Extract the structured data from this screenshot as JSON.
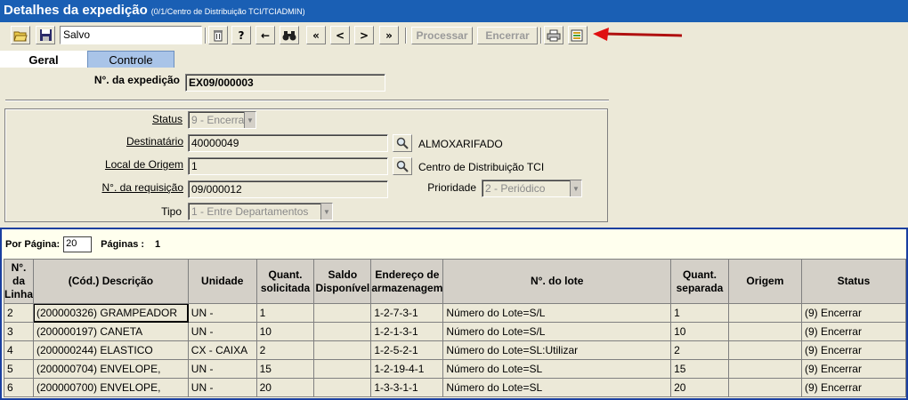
{
  "window": {
    "title": "Detalhes da expedição",
    "subtitle": "(0/1/Centro de Distribuição TCI/TCIADMIN)"
  },
  "toolbar": {
    "status_text": "Salvo",
    "process_label": "Processar",
    "close_label": "Encerrar",
    "icons": [
      "open-folder-icon",
      "save-disk-icon",
      "trash-icon",
      "help-icon",
      "arrow-left-icon",
      "binoculars-icon",
      "first-record-icon",
      "previous-record-icon",
      "next-record-icon",
      "last-record-icon",
      "print-icon",
      "export-report-icon",
      "red-arrow-annotation"
    ]
  },
  "tabs": [
    {
      "label": "Geral",
      "active": true
    },
    {
      "label": "Controle",
      "active": false
    }
  ],
  "header": {
    "shipment_label": "N°. da expedição",
    "shipment_value": "EX09/000003"
  },
  "form": {
    "status_label": "Status",
    "status_value": "9 - Encerra",
    "destinatario_label": "Destinatário",
    "destinatario_value": "40000049",
    "destinatario_name": "ALMOXARIFADO",
    "origem_label": "Local de Origem",
    "origem_value": "1",
    "origem_name": "Centro de Distribuição TCI",
    "requisicao_label": "N°. da requisição",
    "requisicao_value": "09/000012",
    "prioridade_label": "Prioridade",
    "prioridade_value": "2 - Periódico",
    "tipo_label": "Tipo",
    "tipo_value": "1 - Entre Departamentos"
  },
  "pager": {
    "per_page_label": "Por Página:",
    "per_page_value": "20",
    "pages_label": "Páginas :",
    "pages_value": "1"
  },
  "table": {
    "columns": [
      "N°. da Linha",
      "(Cód.) Descrição",
      "Unidade",
      "Quant. solicitada",
      "Saldo Disponível",
      "Endereço de armazenagem",
      "N°. do lote",
      "Quant. separada",
      "Origem",
      "Status"
    ],
    "rows": [
      [
        "2",
        "(200000326) GRAMPEADOR",
        "UN -",
        "1",
        "",
        "1-2-7-3-1",
        "Número do Lote=S/L",
        "1",
        "",
        "(9) Encerrar"
      ],
      [
        "3",
        "(200000197) CANETA",
        "UN -",
        "10",
        "",
        "1-2-1-3-1",
        "Número do Lote=S/L",
        "10",
        "",
        "(9) Encerrar"
      ],
      [
        "4",
        "(200000244) ELASTICO",
        "CX - CAIXA",
        "2",
        "",
        "1-2-5-2-1",
        "Número do Lote=SL:Utilizar",
        "2",
        "",
        "(9) Encerrar"
      ],
      [
        "5",
        "(200000704) ENVELOPE,",
        "UN -",
        "15",
        "",
        "1-2-19-4-1",
        "Número do Lote=SL",
        "15",
        "",
        "(9) Encerrar"
      ],
      [
        "6",
        "(200000700) ENVELOPE,",
        "UN -",
        "20",
        "",
        "1-3-3-1-1",
        "Número do Lote=SL",
        "20",
        "",
        "(9) Encerrar"
      ]
    ]
  },
  "colors": {
    "titlebar": "#1a5fb4",
    "tab_inactive": "#a9c4e8",
    "list_border": "#1a3fa0",
    "list_bg": "#ffffee",
    "annotation_arrow": "#e01010"
  }
}
